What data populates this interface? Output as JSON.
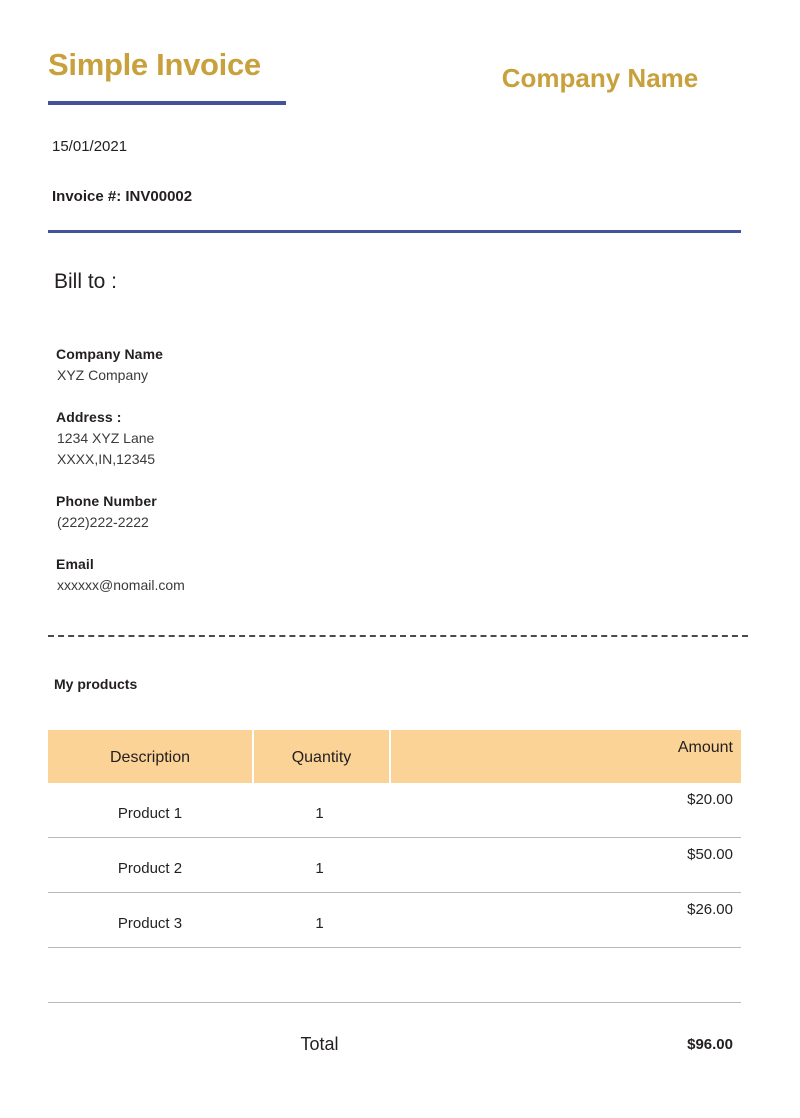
{
  "document": {
    "title": "Simple Invoice",
    "company_name": "Company Name",
    "date": "15/01/2021",
    "invoice_number_label": "Invoice #:",
    "invoice_number": "INV00002"
  },
  "bill_to": {
    "heading": "Bill to :",
    "company_label": "Company Name",
    "company_value": "XYZ Company",
    "address_label": "Address :",
    "address_line1": "1234 XYZ Lane",
    "address_line2": "XXXX,IN,12345",
    "phone_label": "Phone Number",
    "phone_value": "(222)222-2222",
    "email_label": "Email",
    "email_value": "xxxxxx@nomail.com"
  },
  "products": {
    "section_label": "My products",
    "columns": {
      "description": "Description",
      "quantity": "Quantity",
      "amount": "Amount"
    },
    "rows": [
      {
        "description": "Product 1",
        "quantity": "1",
        "amount": "$20.00"
      },
      {
        "description": "Product 2",
        "quantity": "1",
        "amount": "$50.00"
      },
      {
        "description": "Product 3",
        "quantity": "1",
        "amount": "$26.00"
      }
    ],
    "total_label": "Total",
    "total_amount": "$96.00"
  },
  "colors": {
    "gold": "#c8a03c",
    "blue_rule": "#44549b",
    "table_header_bg": "#fbd396",
    "text": "#231f20"
  }
}
